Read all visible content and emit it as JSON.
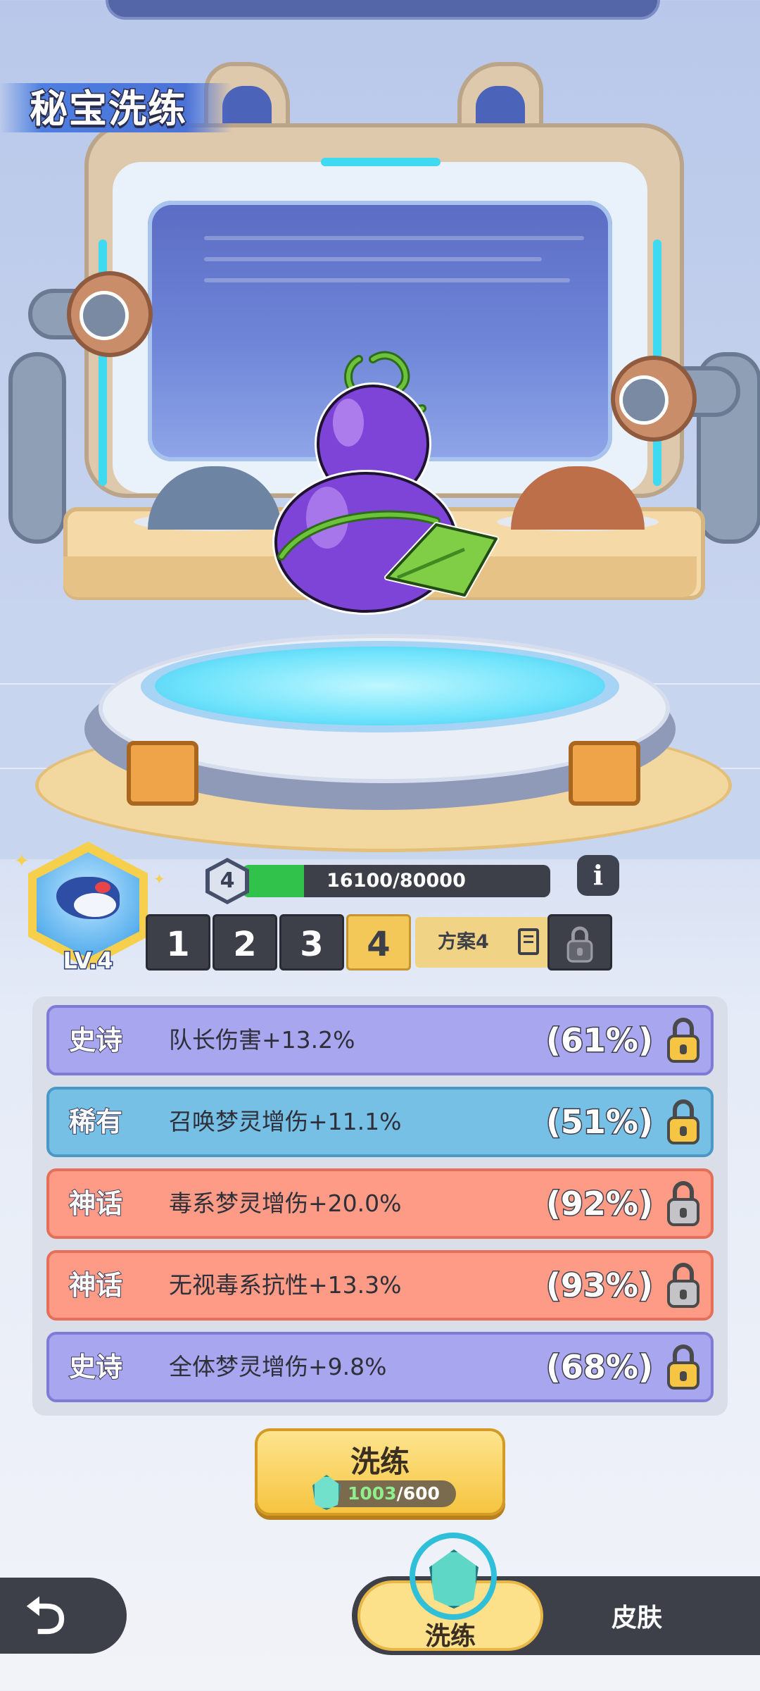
{
  "title": "秘宝洗练",
  "pet": {
    "level_label": "LV.4"
  },
  "treasure": {
    "level": "4",
    "exp_text": "16100/80000",
    "exp_fraction": 0.2
  },
  "plans": {
    "tabs": [
      "1",
      "2",
      "3",
      "4"
    ],
    "active_index": 3,
    "current_name": "方案4"
  },
  "attributes": [
    {
      "quality": "史诗",
      "text": "队长伤害+13.2%",
      "percent": "(61%)",
      "tier": "epic",
      "locked": false
    },
    {
      "quality": "稀有",
      "text": "召唤梦灵增伤+11.1%",
      "percent": "(51%)",
      "tier": "rare",
      "locked": false
    },
    {
      "quality": "神话",
      "text": "毒系梦灵增伤+20.0%",
      "percent": "(92%)",
      "tier": "myth",
      "locked": true
    },
    {
      "quality": "神话",
      "text": "无视毒系抗性+13.3%",
      "percent": "(93%)",
      "tier": "myth",
      "locked": true
    },
    {
      "quality": "史诗",
      "text": "全体梦灵增伤+9.8%",
      "percent": "(68%)",
      "tier": "epic",
      "locked": false
    }
  ],
  "refine_button": {
    "label": "洗练",
    "cost_have": "1003",
    "cost_need": "/600"
  },
  "bottom_nav": {
    "tab_refine": "洗练",
    "tab_skin": "皮肤"
  },
  "icons": {
    "back": "back-arrow-icon",
    "info": "info-icon",
    "lock": "lock-icon",
    "edit": "edit-icon",
    "gem": "crystal-gem-icon"
  }
}
